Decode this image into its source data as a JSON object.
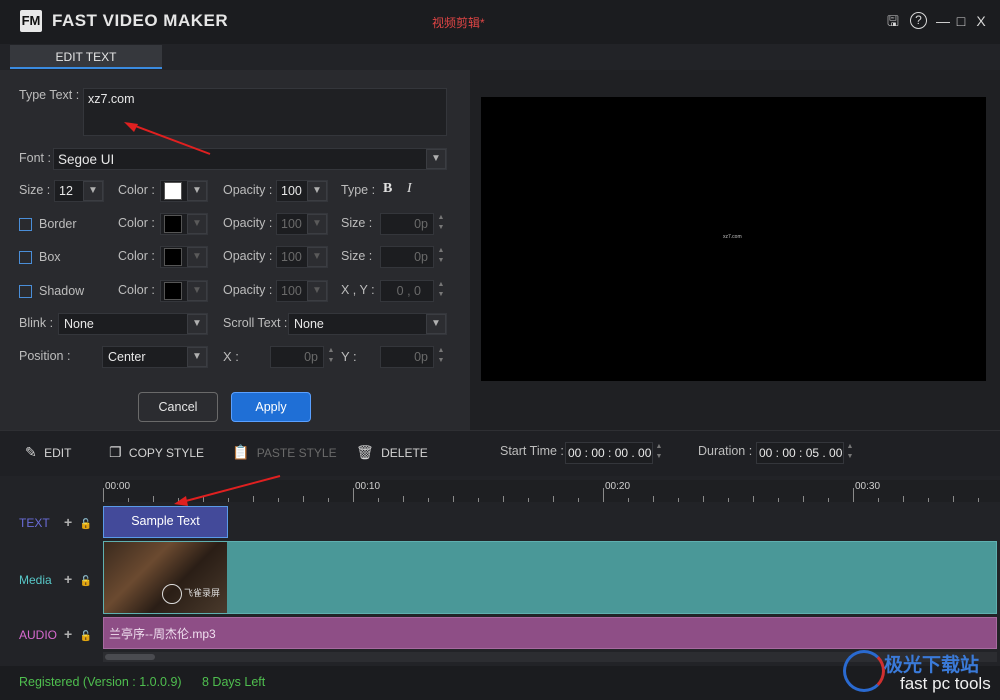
{
  "app": {
    "logo_text": "FM",
    "title": "FAST VIDEO MAKER",
    "document_title": "视频剪辑*",
    "window_controls": [
      "save-icon",
      "help-icon",
      "minimize-icon",
      "maximize-icon",
      "close-icon"
    ],
    "controls_glyphs": [
      "🖫",
      "?",
      "—",
      "□",
      "X"
    ]
  },
  "tabs": [
    {
      "label": "EDIT TEXT",
      "active": true
    }
  ],
  "edit_text": {
    "type_text_label": "Type Text :",
    "type_text_value": "xz7.com",
    "font_label": "Font :",
    "font_value": "Segoe UI",
    "size_label": "Size :",
    "size_value": "12",
    "color_label": "Color :",
    "opacity_label": "Opacity :",
    "opacity_value": "100",
    "type_label": "Type :",
    "bold_glyph": "B",
    "italic_glyph": "I",
    "border_label": "Border",
    "box_label": "Box",
    "shadow_label": "Shadow",
    "size_suffix_label": "Size :",
    "size_px_value": "0p",
    "xy_label": "X , Y :",
    "xy_value": "0 , 0",
    "blink_label": "Blink :",
    "blink_value": "None",
    "scroll_label": "Scroll Text :",
    "scroll_value": "None",
    "position_label": "Position :",
    "position_value": "Center",
    "x_label": "X :",
    "x_value": "0p",
    "y_label": "Y :",
    "y_value": "0p",
    "cancel_label": "Cancel",
    "apply_label": "Apply"
  },
  "preview": {
    "overlay_text": "xz7.com"
  },
  "toolbar": {
    "edit": "EDIT",
    "copy_style": "COPY STYLE",
    "paste_style": "PASTE STYLE",
    "delete": "DELETE",
    "start_time_label": "Start Time :",
    "start_time_value": "00 : 00 : 00 . 00",
    "duration_label": "Duration :",
    "duration_value": "00 : 00 : 05 . 00"
  },
  "timeline": {
    "ruler_labels": [
      "00:00",
      "00:10",
      "00:20",
      "00:30"
    ],
    "tracks": [
      {
        "label": "TEXT",
        "color": "#6a6cd8",
        "clip": "Sample Text"
      },
      {
        "label": "Media",
        "color": "#58c8c8"
      },
      {
        "label": "AUDIO",
        "color": "#d86ad0",
        "clip": "兰亭序--周杰伦.mp3"
      }
    ],
    "add_glyph": "+",
    "lock_glyph": "🔓",
    "thumb_watermark": "飞雀录屏"
  },
  "status": {
    "registered": "Registered (Version : 1.0.0.9)",
    "days_left": "8 Days Left"
  },
  "watermark": {
    "site": "极光下载站",
    "brand": "fast pc tools"
  },
  "colors": {
    "accent": "#3a8be0",
    "status_green": "#4fbf4f",
    "media_track": "#4a9898",
    "audio_track": "#8e4e86",
    "text_clip": "#434a9a"
  }
}
